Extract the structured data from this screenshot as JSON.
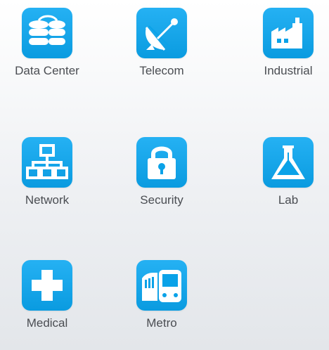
{
  "accent_color": "#0aa2e8",
  "tiles": [
    {
      "label": "Data Center",
      "icon": "database-icon"
    },
    {
      "label": "Telecom",
      "icon": "satellite-dish-icon"
    },
    {
      "label": "Industrial",
      "icon": "factory-icon"
    },
    {
      "label": "Network",
      "icon": "network-hierarchy-icon"
    },
    {
      "label": "Security",
      "icon": "padlock-icon"
    },
    {
      "label": "Lab",
      "icon": "lab-flask-icon"
    },
    {
      "label": "Medical",
      "icon": "medical-cross-icon"
    },
    {
      "label": "Metro",
      "icon": "train-icon"
    }
  ]
}
